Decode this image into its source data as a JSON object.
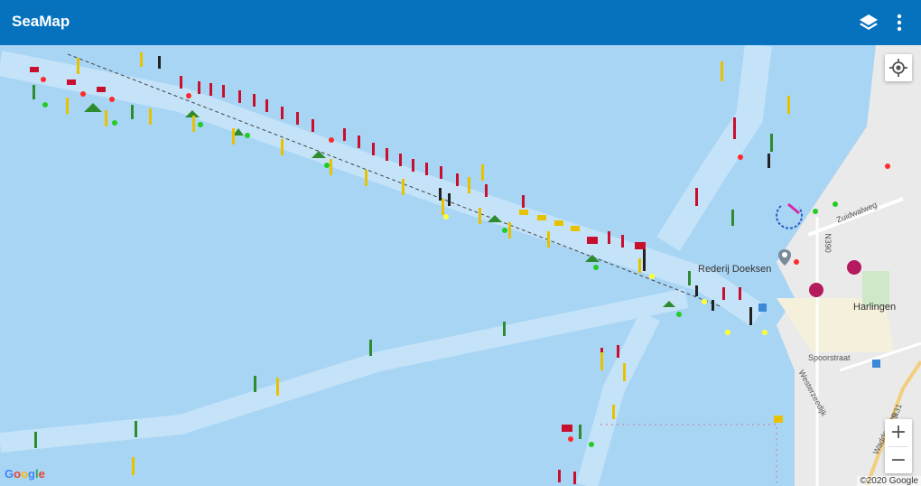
{
  "app": {
    "title": "SeaMap"
  },
  "toolbar": {
    "layers_icon": "layers-icon",
    "more_icon": "more-vert-icon"
  },
  "map": {
    "labels": {
      "ferry": "Rederij Doeksen",
      "town": "Harlingen",
      "street1": "Zuidwalweg",
      "street2": "Spoorstraat",
      "street3": "Westerzeedijk",
      "road1": "N390",
      "road2": "N31",
      "road3": "Waddenweg"
    },
    "attribution": "Google",
    "copyright": "©2020 Google"
  },
  "controls": {
    "locate_icon": "my-location-icon",
    "zoom_in": "+",
    "zoom_out": "−"
  },
  "colors": {
    "appbar": "#0672bd",
    "water": "#a9d5f5",
    "channel": "#c4e3f8",
    "land": "#eaeaea",
    "red_buoy": "#c8102e",
    "green_buoy": "#2e8b2e",
    "yellow_buoy": "#e6c200"
  }
}
